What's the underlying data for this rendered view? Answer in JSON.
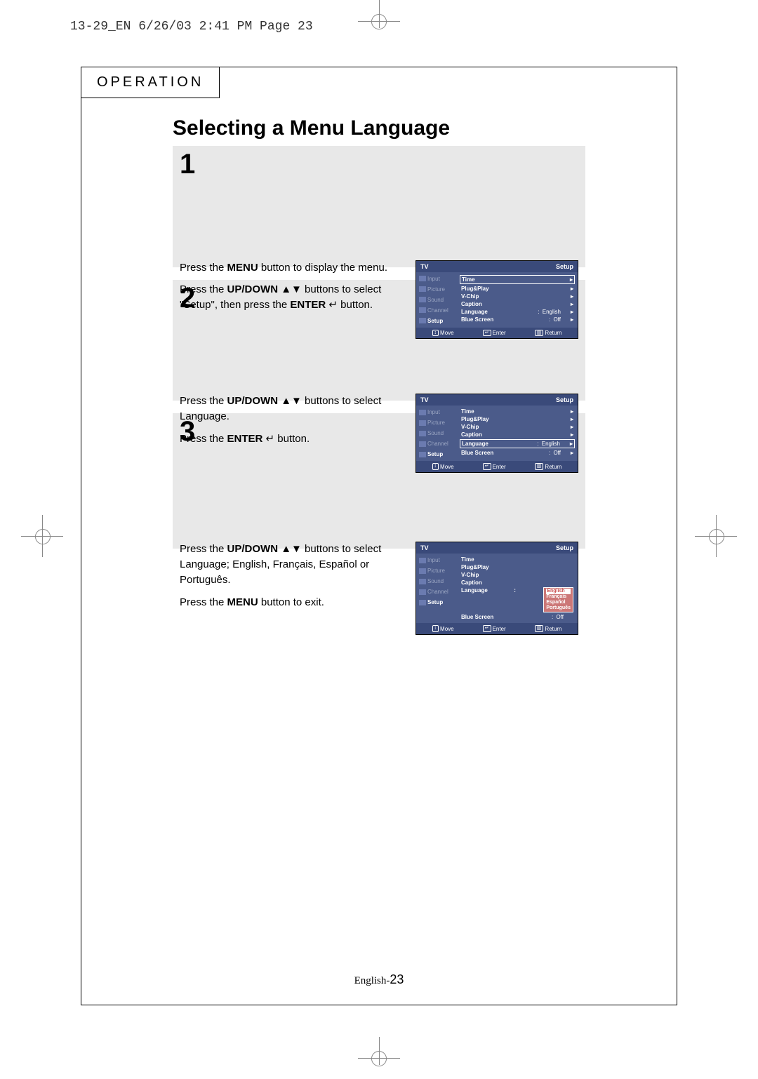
{
  "slug": "13-29_EN  6/26/03 2:41 PM  Page 23",
  "section": "OPERATION",
  "title": "Selecting a Menu Language",
  "page_footer": {
    "lang": "English-",
    "num": "23"
  },
  "steps": [
    {
      "num": "1",
      "paras": [
        [
          {
            "t": "Press the "
          },
          {
            "t": "MENU",
            "b": true
          },
          {
            "t": " button to display the menu."
          }
        ],
        [
          {
            "t": "Press the "
          },
          {
            "t": "UP/DOWN",
            "b": true
          },
          {
            "t": " ▲▼ buttons to select \"Setup\", then press the "
          },
          {
            "t": "ENTER",
            "b": true
          },
          {
            "t": " ↵  button."
          }
        ]
      ],
      "osd": {
        "tl": "TV",
        "tr": "Setup",
        "side": [
          "Input",
          "Picture",
          "Sound",
          "Channel",
          "Setup"
        ],
        "active": 4,
        "rows": [
          {
            "label": "Time",
            "box": true,
            "arrow": true
          },
          {
            "label": "Plug&Play",
            "arrow": true
          },
          {
            "label": "V-Chip",
            "arrow": true
          },
          {
            "label": "Caption",
            "arrow": true
          },
          {
            "label": "Language",
            "val": "English",
            "colon": true,
            "arrow": true
          },
          {
            "label": "Blue Screen",
            "val": "Off",
            "colon": true,
            "arrow": true
          }
        ],
        "hints": [
          {
            "ic": "↕",
            "t": "Move"
          },
          {
            "ic": "↵",
            "t": "Enter"
          },
          {
            "ic": "▥",
            "t": "Return"
          }
        ]
      }
    },
    {
      "num": "2",
      "paras": [
        [
          {
            "t": "Press the "
          },
          {
            "t": "UP/DOWN",
            "b": true
          },
          {
            "t": " ▲▼ buttons to select Language."
          }
        ],
        [
          {
            "t": "Press the "
          },
          {
            "t": "ENTER",
            "b": true
          },
          {
            "t": " ↵  button."
          }
        ]
      ],
      "osd": {
        "tl": "TV",
        "tr": "Setup",
        "side": [
          "Input",
          "Picture",
          "Sound",
          "Channel",
          "Setup"
        ],
        "active": 4,
        "rows": [
          {
            "label": "Time",
            "arrow": true
          },
          {
            "label": "Plug&Play",
            "arrow": true
          },
          {
            "label": "V-Chip",
            "arrow": true
          },
          {
            "label": "Caption",
            "arrow": true
          },
          {
            "label": "Language",
            "val": "English",
            "colon": true,
            "arrow": true,
            "box": true
          },
          {
            "label": "Blue Screen",
            "val": "Off",
            "colon": true,
            "arrow": true
          }
        ],
        "hints": [
          {
            "ic": "↕",
            "t": "Move"
          },
          {
            "ic": "↵",
            "t": "Enter"
          },
          {
            "ic": "▥",
            "t": "Return"
          }
        ]
      }
    },
    {
      "num": "3",
      "paras": [
        [
          {
            "t": "Press the "
          },
          {
            "t": "UP/DOWN",
            "b": true
          },
          {
            "t": " ▲▼ buttons to select Language; English, Français, Español or Português."
          }
        ],
        [
          {
            "t": "Press the "
          },
          {
            "t": "MENU",
            "b": true
          },
          {
            "t": " button to exit."
          }
        ]
      ],
      "osd": {
        "tl": "TV",
        "tr": "Setup",
        "side": [
          "Input",
          "Picture",
          "Sound",
          "Channel",
          "Setup"
        ],
        "active": 4,
        "rows": [
          {
            "label": "Time"
          },
          {
            "label": "Plug&Play"
          },
          {
            "label": "V-Chip"
          },
          {
            "label": "Caption"
          },
          {
            "label": "Language",
            "colon": true,
            "popup": [
              "English",
              "Français",
              "Español",
              "Português"
            ],
            "popupSel": 0
          },
          {
            "label": "Blue Screen",
            "val": "Off",
            "colon": true
          }
        ],
        "hints": [
          {
            "ic": "↕",
            "t": "Move"
          },
          {
            "ic": "↵",
            "t": "Enter"
          },
          {
            "ic": "▥",
            "t": "Return"
          }
        ]
      }
    }
  ]
}
